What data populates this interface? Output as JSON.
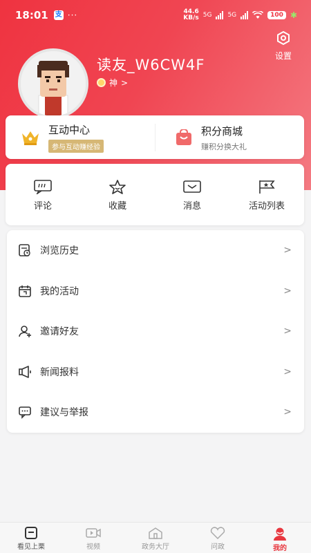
{
  "status_bar": {
    "time": "18:01",
    "app_badge": "支",
    "dots": "···",
    "net_speed": "44.6",
    "net_unit": "KB/s",
    "net_type_1": "5G",
    "net_type_2": "5G",
    "battery": "100"
  },
  "header": {
    "settings_label": "设置",
    "username": "读友_W6CW4F",
    "level_label": "神"
  },
  "top_card": {
    "interaction_title": "互动中心",
    "interaction_tag": "参与互动赚经验",
    "mall_title": "积分商城",
    "mall_sub": "赚积分换大礼"
  },
  "shortcuts": [
    {
      "label": "评论",
      "icon": "comment-icon"
    },
    {
      "label": "收藏",
      "icon": "star-icon"
    },
    {
      "label": "消息",
      "icon": "mail-icon"
    },
    {
      "label": "活动列表",
      "icon": "flag-icon"
    }
  ],
  "menu": [
    {
      "label": "浏览历史",
      "icon": "history-icon"
    },
    {
      "label": "我的活动",
      "icon": "calendar-icon"
    },
    {
      "label": "邀请好友",
      "icon": "add-user-icon"
    },
    {
      "label": "新闻报料",
      "icon": "megaphone-icon"
    },
    {
      "label": "建议与举报",
      "icon": "feedback-icon"
    }
  ],
  "tabbar": [
    {
      "label": "看见上栗",
      "icon": "home-icon"
    },
    {
      "label": "视频",
      "icon": "video-icon"
    },
    {
      "label": "政务大厅",
      "icon": "hall-icon"
    },
    {
      "label": "问政",
      "icon": "heart-icon"
    },
    {
      "label": "我的",
      "icon": "user-icon"
    }
  ],
  "colors": {
    "brand_red": "#ef3340",
    "tag_gold": "#d6b775",
    "active_tab": "#e8373f"
  }
}
